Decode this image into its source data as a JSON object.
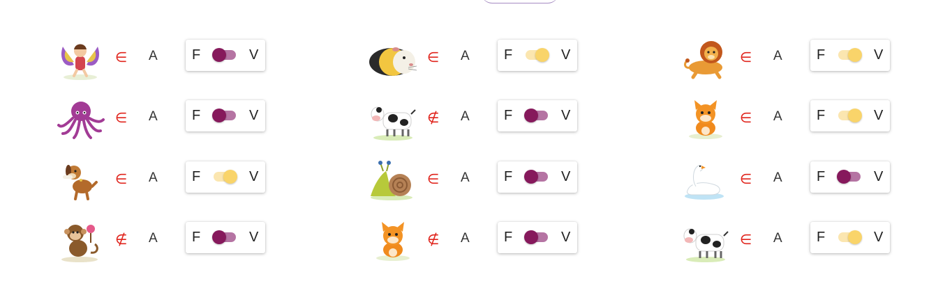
{
  "set_label": "A",
  "switch": {
    "false_label": "F",
    "true_label": "V"
  },
  "colors": {
    "relation_symbol": "#e0241c",
    "toggle_off_track": "#b574a3",
    "toggle_off_knob": "#86195c",
    "toggle_on_track": "#fbe6b0",
    "toggle_on_knob": "#f9d46a"
  },
  "columns": [
    {
      "rows": [
        {
          "animal": "fairy-icon",
          "relation": "∈",
          "toggle_state": "F"
        },
        {
          "animal": "octopus-icon",
          "relation": "∈",
          "toggle_state": "F"
        },
        {
          "animal": "dog-icon",
          "relation": "∈",
          "toggle_state": "V"
        },
        {
          "animal": "monkey-icon",
          "relation": "∉",
          "toggle_state": "F"
        }
      ]
    },
    {
      "rows": [
        {
          "animal": "guinea-pig-icon",
          "relation": "∈",
          "toggle_state": "V"
        },
        {
          "animal": "cow-icon",
          "relation": "∉",
          "toggle_state": "F"
        },
        {
          "animal": "snail-icon",
          "relation": "∈",
          "toggle_state": "F"
        },
        {
          "animal": "cat-icon",
          "relation": "∉",
          "toggle_state": "F"
        }
      ]
    },
    {
      "rows": [
        {
          "animal": "lion-icon",
          "relation": "∈",
          "toggle_state": "V"
        },
        {
          "animal": "cat-icon",
          "relation": "∈",
          "toggle_state": "V"
        },
        {
          "animal": "swan-icon",
          "relation": "∈",
          "toggle_state": "F"
        },
        {
          "animal": "cow-icon",
          "relation": "∈",
          "toggle_state": "V"
        }
      ]
    }
  ]
}
